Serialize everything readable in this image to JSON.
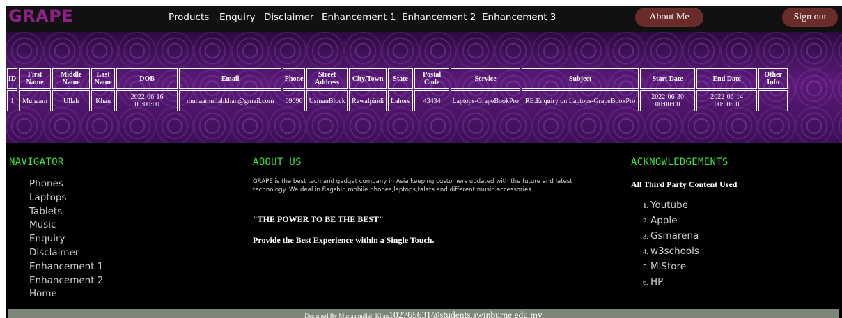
{
  "header": {
    "logo": "GRAPE",
    "nav": [
      "Products",
      "Enquiry",
      "Disclaimer",
      "Enhancement 1",
      "Enhancement 2",
      "Enhancement 3"
    ],
    "about_button": "About Me",
    "signout_button": "Sign out"
  },
  "table": {
    "headers": [
      "ID",
      "First Name",
      "Middle Name",
      "Last Name",
      "DOB",
      "Email",
      "Phone",
      "Street Address",
      "City/Town",
      "State",
      "Postal Code",
      "Service",
      "Subject",
      "Start Date",
      "End Date",
      "Other Info"
    ],
    "rows": [
      [
        "1",
        "Munaam",
        "Ullah",
        "Khan",
        "2022-06-16 00:00:00",
        "munaamullahkhan@gmail.com",
        "09090",
        "UsmanBlock",
        "Rawalpindi",
        "Lahore",
        "43434",
        "Laptops-GrapeBookPro",
        "RE:Enquiry on Laptops-GrapeBookPro",
        "2022-06-30 00:00:00",
        "2022-06-14 00:00:00",
        ""
      ]
    ]
  },
  "navigator": {
    "title": "NAVIGATOR",
    "items": [
      "Phones",
      "Laptops",
      "Tablets",
      "Music",
      "Enquiry",
      "Disclaimer",
      "Enhancement 1",
      "Enhancement 2",
      "Home"
    ]
  },
  "about": {
    "title": "ABOUT US",
    "paragraph": "GRAPE is the best tech and gadget company in Asia keeping customers updated with the future and latest technology. We deal in flagship mobile phones,laptops,talets and different music accessories.",
    "slogan": "\"THE POWER TO BE THE BEST\"",
    "tagline": "Provide the Best Experience within a Single Touch."
  },
  "acknowledgements": {
    "title": "ACKNOWLEDGEMENTS",
    "subtitle": "All Third Party Content Used",
    "items": [
      "Youtube",
      "Apple",
      "Gsmarena",
      "w3schools",
      "MiStore",
      "HP"
    ]
  },
  "footer": {
    "designed_by": "Designed By Munaamullah Khan",
    "email": "102765631@students.swinburne.edu.my"
  },
  "colors": {
    "logo": "#8e1f86",
    "section_title": "#3fe03f",
    "pill_button": "#6a2b2b",
    "banner": "#3a0f55",
    "footer_bar": "#7e857b"
  }
}
